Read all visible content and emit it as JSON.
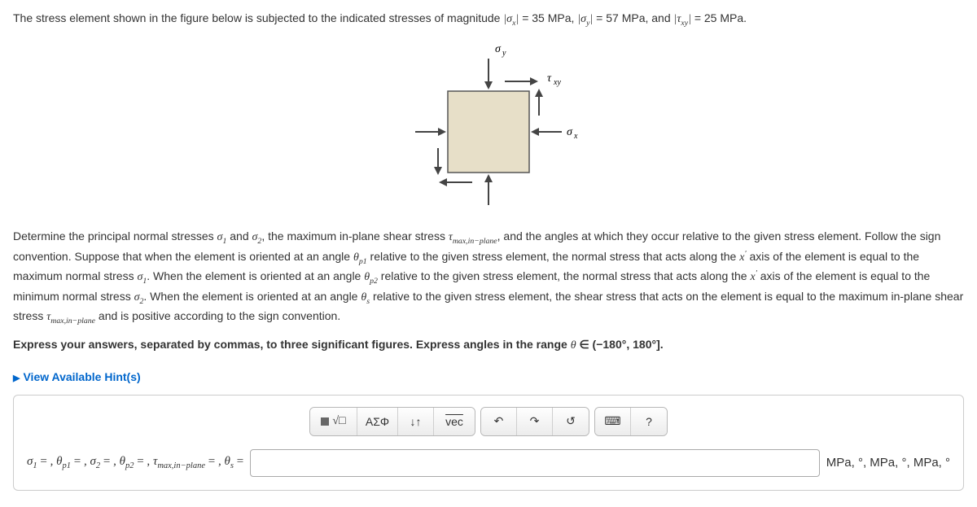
{
  "intro": {
    "prefix": "The stress element shown in the figure below is subjected to the indicated stresses of magnitude ",
    "sx_label": "|σₓ| = 35 MPa",
    "sy_label": "|σ_y| = 57 MPa",
    "txy_label": "|τ_{xy}| = 25 MPa",
    "suffix_period": "."
  },
  "figure": {
    "sigma_y": "σy",
    "sigma_x": "σx",
    "tau_xy": "τxy"
  },
  "question": {
    "p1": "Determine the principal normal stresses σ₁ and σ₂, the maximum in-plane shear stress τ_{max,in−plane}, and the angles at which they occur relative to the given stress element. Follow the sign convention. Suppose that when the element is oriented at an angle θ_{p1} relative to the given stress element, the normal stress that acts along the x′ axis of the element is equal to the maximum normal stress σ₁. When the element is oriented at an angle θ_{p2} relative to the given stress element, the normal stress that acts along the x′ axis of the element is equal to the minimum normal stress σ₂. When the element is oriented at an angle θ_s relative to the given stress element, the shear stress that acts on the element is equal to the maximum in-plane shear stress τ_{max,in−plane} and is positive according to the sign convention.",
    "instruct_plain": "Express your answers, separated by commas, to three significant figures. Express angles in the range ",
    "range": "θ ∈ (−180°, 180°]."
  },
  "hints": {
    "label": "View Available Hint(s)"
  },
  "toolbar": {
    "template": "▢√",
    "greek": "ΑΣΦ",
    "subscript": "↓↑",
    "vec": "vec",
    "undo": "↶",
    "redo": "↷",
    "reset": "↺",
    "keyboard": "⌨",
    "help": "?"
  },
  "answer": {
    "labels": "σ₁ = , θ_{p1} = , σ₂ = , θ_{p2} = , τ_{max,in−plane} = , θ_s =",
    "units": "MPa, °, MPa, °, MPa, °"
  }
}
